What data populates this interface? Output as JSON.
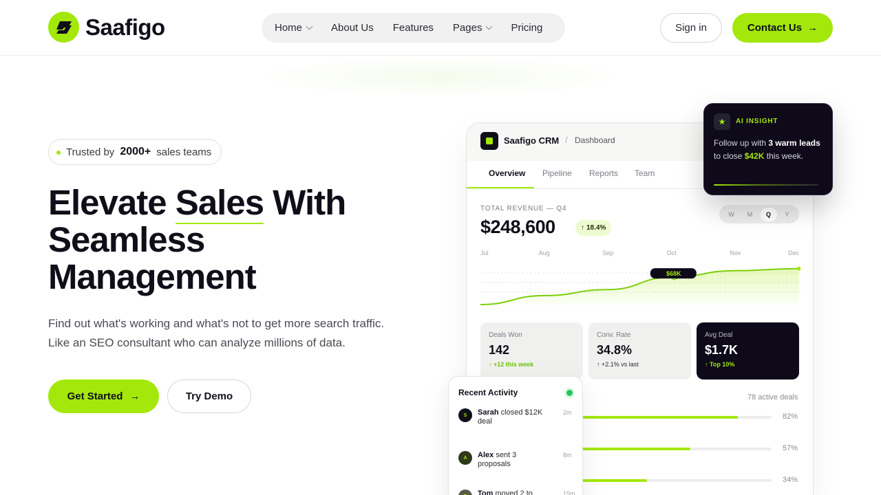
{
  "nav": {
    "brand": "Saafigo",
    "menu": [
      {
        "label": "Home",
        "dropdown": true
      },
      {
        "label": "About Us",
        "dropdown": false
      },
      {
        "label": "Features",
        "dropdown": false
      },
      {
        "label": "Pages",
        "dropdown": true
      },
      {
        "label": "Pricing",
        "dropdown": false
      }
    ],
    "signin": "Sign in",
    "contact": "Contact Us",
    "arrow": "→"
  },
  "hero": {
    "badge_prefix": "Trusted by",
    "badge_count": "2000+",
    "badge_suffix": "sales teams",
    "title_1": "Elevate",
    "title_highlight": "Sales",
    "title_2": "With",
    "title_3": "Seamless",
    "title_4": "Management",
    "subtitle_1": "Find out what's working and what's not to get more search traffic.",
    "subtitle_2": "Like an SEO consultant who can analyze millions of data.",
    "cta_primary": "Get Started",
    "cta_secondary": "Try Demo"
  },
  "dashboard": {
    "app_name": "Saafigo CRM",
    "separator": "/",
    "crumb": "Dashboard",
    "tabs": [
      "Overview",
      "Pipeline",
      "Reports",
      "Team"
    ],
    "active_tab": "Overview",
    "revenue_label": "TOTAL REVENUE — Q4",
    "revenue_value": "$248,600",
    "revenue_delta": "18.4%",
    "periods": [
      "W",
      "M",
      "Q",
      "Y"
    ],
    "active_period": "Q",
    "stats": [
      {
        "label": "Deals Won",
        "value": "142",
        "delta": "+12 this week"
      },
      {
        "label": "Conv. Rate",
        "value": "34.8%",
        "delta": "+2.1% vs last"
      },
      {
        "label": "Avg Deal",
        "value": "$1.7K",
        "delta": "Top 10%"
      }
    ],
    "active_deals": "78 active deals",
    "bars": [
      {
        "label": "82%",
        "value": 0.82
      },
      {
        "label": "57%",
        "value": 0.57
      },
      {
        "label": "34%",
        "value": 0.34
      }
    ]
  },
  "chart_data": {
    "type": "area",
    "categories": [
      "Jul",
      "Aug",
      "Sep",
      "Oct",
      "Nov",
      "Dec"
    ],
    "values": [
      0,
      18,
      30,
      55,
      68,
      72
    ],
    "ylim": [
      0,
      80
    ],
    "tooltip": {
      "label": "$68K",
      "category": "Oct"
    },
    "grid": true,
    "line_color": "#7ccf0a",
    "fill_color": "#a3e80a"
  },
  "ai_insight": {
    "icon": "star",
    "tag": "AI INSIGHT",
    "text_1": "Follow up with",
    "text_bold": "3 warm leads",
    "text_2": "to close",
    "text_amount": "$42K",
    "text_3": "this week."
  },
  "activity": {
    "title": "Recent Activity",
    "items": [
      {
        "initial": "S",
        "name": "Sarah",
        "action": "closed $12K deal",
        "time": "2m"
      },
      {
        "initial": "A",
        "name": "Alex",
        "action": "sent 3 proposals",
        "time": "8m"
      },
      {
        "initial": "T",
        "name": "Tom",
        "action": "moved 2 to",
        "time": "15m"
      }
    ]
  },
  "colors": {
    "accent": "#a3e80a",
    "dark": "#0e0a1a",
    "text": "#0f0f1a",
    "online": "#22c55e"
  }
}
